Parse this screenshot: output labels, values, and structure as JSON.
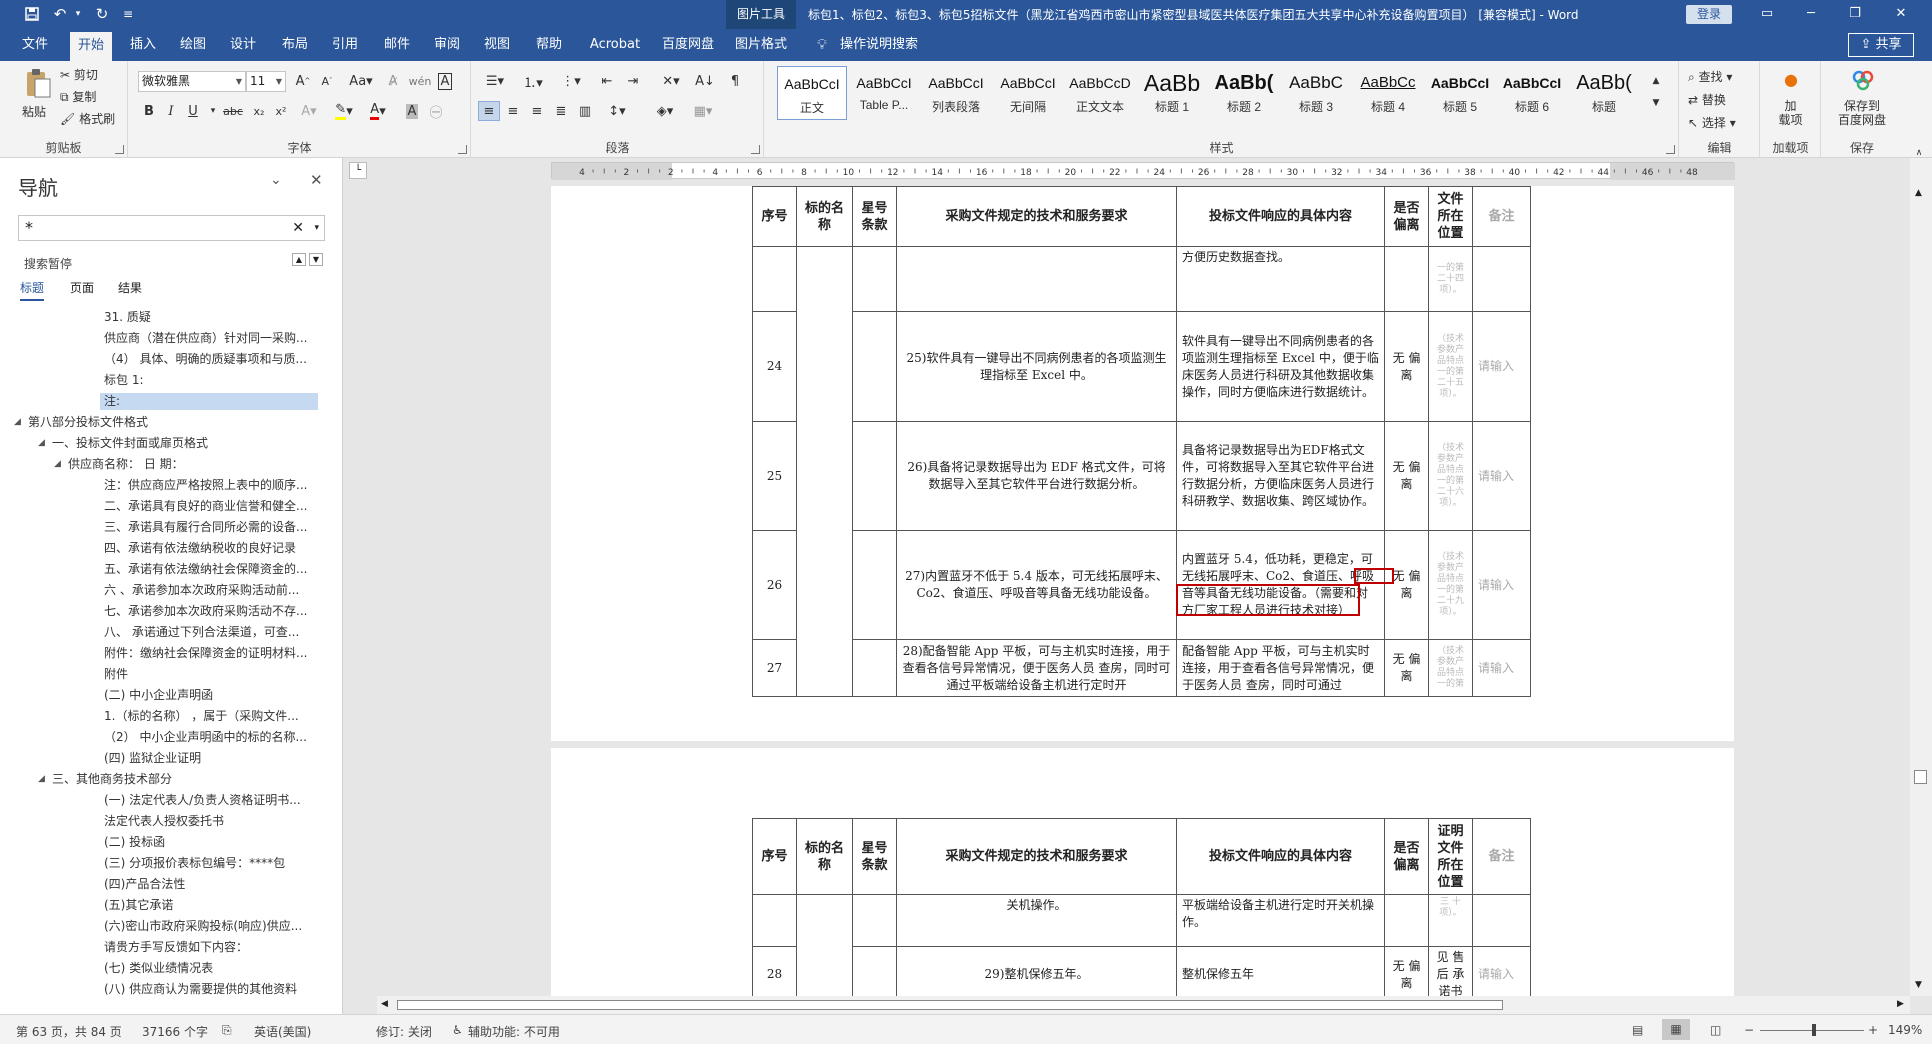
{
  "titlebar": {
    "context_tab": "图片工具",
    "doc_title": "标包1、标包2、标包3、标包5招标文件（黑龙江省鸡西市密山市紧密型县域医共体医疗集团五大共享中心补充设备购置项目） [兼容模式] - Word",
    "login": "登录"
  },
  "tabs": [
    "文件",
    "开始",
    "插入",
    "绘图",
    "设计",
    "布局",
    "引用",
    "邮件",
    "审阅",
    "视图",
    "帮助",
    "Acrobat",
    "百度网盘",
    "图片格式"
  ],
  "tell_me": "操作说明搜索",
  "share": "共享",
  "ribbon": {
    "clipboard": {
      "paste": "粘贴",
      "cut": "剪切",
      "copy": "复制",
      "format_painter": "格式刷",
      "label": "剪贴板"
    },
    "font": {
      "name": "微软雅黑",
      "size": "11",
      "label": "字体"
    },
    "paragraph": {
      "label": "段落"
    },
    "styles": {
      "label": "样式",
      "items": [
        {
          "preview": "AaBbCcI",
          "name": "正文"
        },
        {
          "preview": "AaBbCcI",
          "name": "Table P..."
        },
        {
          "preview": "AaBbCcI",
          "name": "列表段落"
        },
        {
          "preview": "AaBbCcI",
          "name": "无间隔"
        },
        {
          "preview": "AaBbCcD",
          "name": "正文文本"
        },
        {
          "preview": "AaBb",
          "name": "标题 1"
        },
        {
          "preview": "AaBb(",
          "name": "标题 2"
        },
        {
          "preview": "AaBbC",
          "name": "标题 3"
        },
        {
          "preview": "AaBbCc",
          "name": "标题 4"
        },
        {
          "preview": "AaBbCcI",
          "name": "标题 5"
        },
        {
          "preview": "AaBbCcI",
          "name": "标题 6"
        },
        {
          "preview": "AaBb(",
          "name": "标题"
        }
      ]
    },
    "editing": {
      "find": "查找",
      "replace": "替换",
      "select": "选择",
      "label": "编辑"
    },
    "addins": {
      "item": "加\n载项",
      "label": "加载项"
    },
    "save": {
      "item": "保存到\n百度网盘",
      "label": "保存"
    }
  },
  "nav": {
    "title": "导航",
    "search_value": "*",
    "search_paused": "搜索暂停",
    "tabs": [
      "标题",
      "页面",
      "结果"
    ],
    "items": [
      {
        "text": "31. 质疑",
        "indent": 3
      },
      {
        "text": "供应商（潜在供应商）针对同一采购...",
        "indent": 3
      },
      {
        "text": "（4） 具体、明确的质疑事项和与质...",
        "indent": 3
      },
      {
        "text": "标包 1:",
        "indent": 3
      },
      {
        "text": "注:",
        "indent": 3,
        "selected": true
      },
      {
        "text": "第八部分投标文件格式",
        "indent": 0,
        "caret": true
      },
      {
        "text": "一、投标文件封面或扉页格式",
        "indent": 1,
        "caret": true
      },
      {
        "text": "供应商名称：                      日 期：",
        "indent": 2,
        "caret": true
      },
      {
        "text": "注：供应商应严格按照上表中的顺序...",
        "indent": 3
      },
      {
        "text": "二、承诺具有良好的商业信誉和健全...",
        "indent": 3
      },
      {
        "text": "三、承诺具有履行合同所必需的设备...",
        "indent": 3
      },
      {
        "text": "四、承诺有依法缴纳税收的良好记录",
        "indent": 3
      },
      {
        "text": "五、承诺有依法缴纳社会保障资金的...",
        "indent": 3
      },
      {
        "text": "六 、承诺参加本次政府采购活动前...",
        "indent": 3
      },
      {
        "text": "七、承诺参加本次政府采购活动不存...",
        "indent": 3
      },
      {
        "text": "八、 承诺通过下列合法渠道，可查...",
        "indent": 3
      },
      {
        "text": "附件：缴纳社会保障资金的证明材料...",
        "indent": 3
      },
      {
        "text": "附件",
        "indent": 3
      },
      {
        "text": "(二) 中小企业声明函",
        "indent": 3
      },
      {
        "text": "1.（标的名称）     ，属于（采购文件...",
        "indent": 3
      },
      {
        "text": "（2） 中小企业声明函中的标的名称...",
        "indent": 3
      },
      {
        "text": "(四) 监狱企业证明",
        "indent": 3
      },
      {
        "text": "三、其他商务技术部分",
        "indent": 1,
        "caret": true
      },
      {
        "text": "(一) 法定代表人/负责人资格证明书...",
        "indent": 3
      },
      {
        "text": "法定代表人授权委托书",
        "indent": 3
      },
      {
        "text": "(二) 投标函",
        "indent": 3
      },
      {
        "text": "(三) 分项报价表标包编号：****包",
        "indent": 3
      },
      {
        "text": "(四)产品合法性",
        "indent": 3
      },
      {
        "text": "(五)其它承诺",
        "indent": 3
      },
      {
        "text": "(六)密山市政府采购投标(响应)供应...",
        "indent": 3
      },
      {
        "text": "请贵方手写反馈如下内容：",
        "indent": 3
      },
      {
        "text": "(七) 类似业绩情况表",
        "indent": 3
      },
      {
        "text": "(八) 供应商认为需要提供的其他资料",
        "indent": 3
      }
    ]
  },
  "ruler_numbers": [
    "4",
    "2",
    "2",
    "4",
    "6",
    "8",
    "10",
    "12",
    "14",
    "16",
    "18",
    "20",
    "22",
    "24",
    "26",
    "28",
    "30",
    "32",
    "34",
    "36",
    "38",
    "40",
    "42",
    "44",
    "46",
    "48"
  ],
  "table1": {
    "headers": [
      "序号",
      "标的名称",
      "星号条款",
      "采购文件规定的技术和服务要求",
      "投标文件响应的具体内容",
      "是否偏离",
      "文件所在位置",
      "备注"
    ],
    "rows": [
      {
        "no": "",
        "req": "",
        "resp": "方便历史数据查找。",
        "dev": "",
        "loc": "一的第二十四项）。",
        "note": ""
      },
      {
        "no": "24",
        "req": "25)软件具有一键导出不同病例患者的各项监测生理指标至 Excel 中。",
        "resp": "软件具有一键导出不同病例患者的各项监测生理指标至 Excel 中，便于临床医务人员进行科研及其他数据收集操作，同时方便临床进行数据统计。",
        "dev": "无 偏离",
        "loc": "（技术参数产品特点一的第二十五项）。",
        "note": "请输入"
      },
      {
        "no": "25",
        "req": "26)具备将记录数据导出为 EDF 格式文件，可将数据导入至其它软件平台进行数据分析。",
        "resp": "具备将记录数据导出为EDF格式文件，可将数据导入至其它软件平台进行数据分析，方便临床医务人员进行科研教学、数据收集、跨区域协作。",
        "dev": "无 偏离",
        "loc": "（技术参数产品特点一的第二十六项）。",
        "note": "请输入"
      },
      {
        "no": "26",
        "req": "27)内置蓝牙不低于 5.4 版本，可无线拓展呼末、Co2、食道压、呼吸音等具备无线功能设备。",
        "resp": "内置蓝牙 5.4，低功耗，更稳定，可无线拓展呼末、Co2、食道压、呼吸音等具备无线功能设备。（需要和对方厂家工程人员进行技术对接）",
        "dev": "无 偏离",
        "loc": "（技术参数产品特点一的第二十九项）。",
        "note": "请输入"
      },
      {
        "no": "27",
        "req": "28)配备智能 App 平板，可与主机实时连接，用于查看各信号异常情况，便于医务人员 查房，同时可通过平板端给设备主机进行定时开",
        "resp": "配备智能 App 平板，可与主机实时连接，用于查看各信号异常情况，便于医务人员 查房，同时可通过",
        "dev": "无 偏离",
        "loc": "（技术参数产品特点一的第",
        "note": "请输入"
      }
    ]
  },
  "table2": {
    "headers": [
      "序号",
      "标的名称",
      "星号条款",
      "采购文件规定的技术和服务要求",
      "投标文件响应的具体内容",
      "是否偏离",
      "证明文件所在位置",
      "备注"
    ],
    "rows": [
      {
        "no": "",
        "req": "关机操作。",
        "resp": "平板端给设备主机进行定时开关机操作。",
        "dev": "",
        "loc": "三 十项）。",
        "note": ""
      },
      {
        "no": "28",
        "req": "29)整机保修五年。",
        "resp": "整机保修五年",
        "dev": "无 偏离",
        "loc": "见 售后 承诺书",
        "note": "请输入"
      }
    ]
  },
  "status": {
    "page": "第 63 页，共 84 页",
    "words": "37166 个字",
    "lang": "英语(美国)",
    "track": "修订: 关闭",
    "access": "辅助功能: 不可用",
    "zoom": "149%"
  },
  "colors": {
    "accent": "#2b579a",
    "highlight_box": "#c00000",
    "nav_selected": "#c5d9f1"
  }
}
